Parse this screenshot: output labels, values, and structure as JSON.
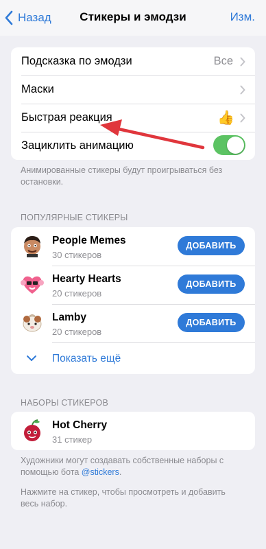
{
  "navbar": {
    "back_label": "Назад",
    "title": "Стикеры и эмодзи",
    "edit_label": "Изм."
  },
  "settings": {
    "emoji_hint": {
      "label": "Подсказка по эмодзи",
      "value": "Все"
    },
    "masks": {
      "label": "Маски"
    },
    "quick_reaction": {
      "label": "Быстрая реакция",
      "value": "👍"
    },
    "loop_animation": {
      "label": "Зациклить анимацию",
      "enabled": true
    },
    "footnote": "Анимированные стикеры будут проигрываться без остановки."
  },
  "popular": {
    "header": "ПОПУЛЯРНЫЕ СТИКЕРЫ",
    "items": [
      {
        "name": "People Memes",
        "count": "30 стикеров",
        "button": "ДОБАВИТЬ"
      },
      {
        "name": "Hearty Hearts",
        "count": "20 стикеров",
        "button": "ДОБАВИТЬ"
      },
      {
        "name": "Lamby",
        "count": "20 стикеров",
        "button": "ДОБАВИТЬ"
      }
    ],
    "show_more": "Показать ещё"
  },
  "sets": {
    "header": "НАБОРЫ СТИКЕРОВ",
    "items": [
      {
        "name": "Hot Cherry",
        "count": "31 стикер"
      }
    ],
    "footnote_pre": "Художники могут создавать собственные наборы с помощью бота ",
    "footnote_link": "@stickers",
    "footnote_post": ".",
    "footnote2": "Нажмите на стикер, чтобы просмотреть и добавить весь набор."
  },
  "colors": {
    "accent": "#2f7ad8",
    "toggle_on": "#5cc363",
    "annotation_arrow": "#e0363c"
  }
}
